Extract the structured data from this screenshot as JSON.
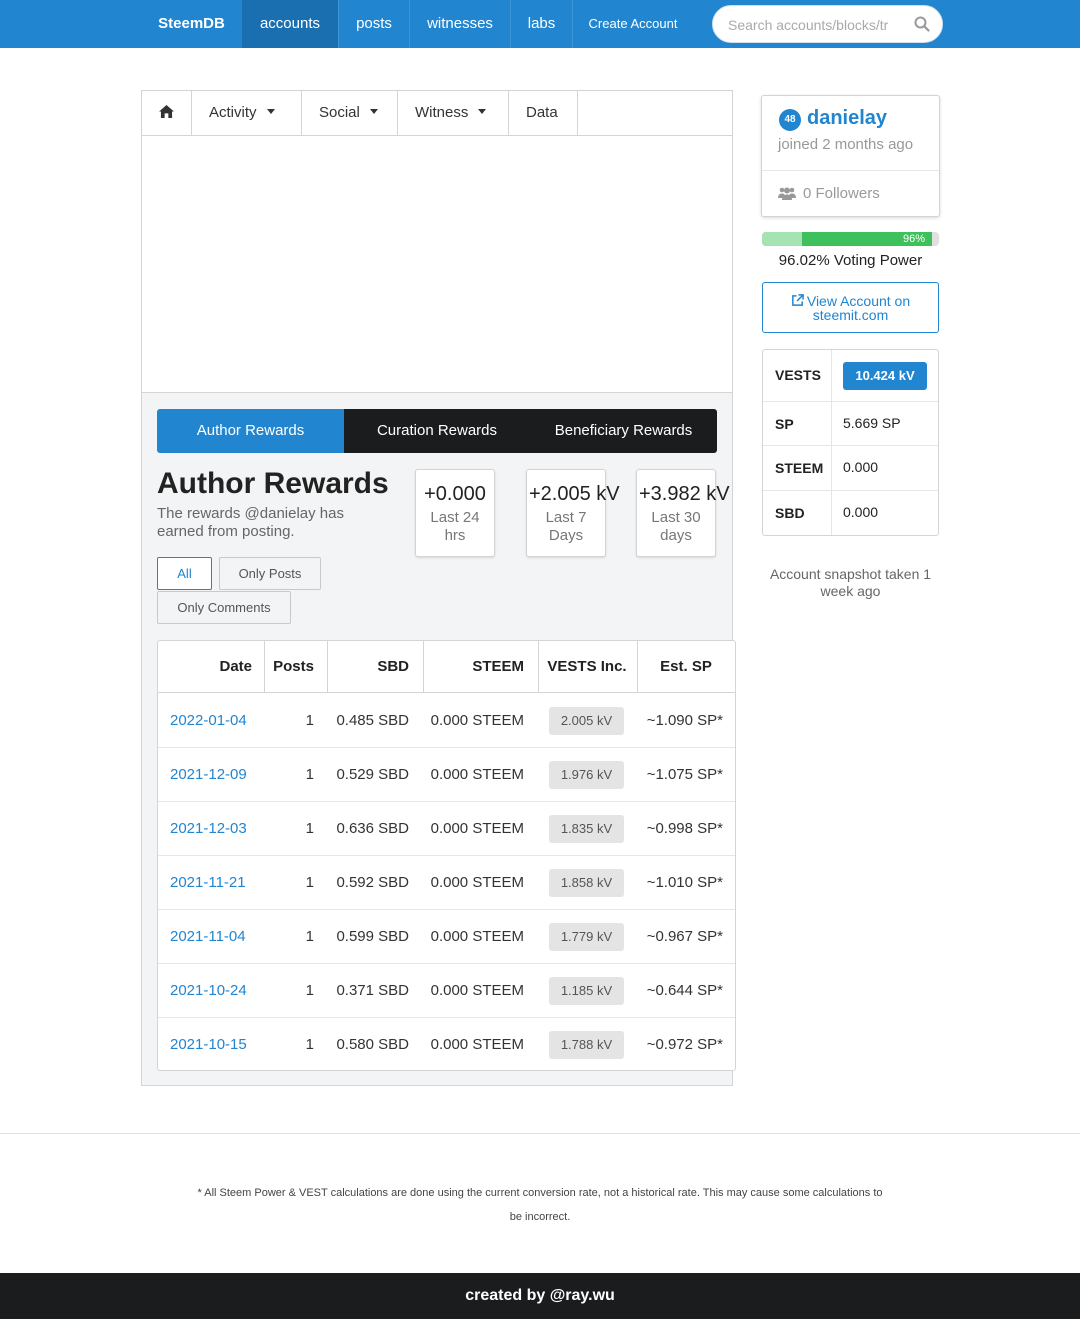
{
  "nav": {
    "brand": "SteemDB",
    "items": [
      "accounts",
      "posts",
      "witnesses",
      "labs"
    ],
    "create_account": "Create Account",
    "search_placeholder": "Search accounts/blocks/tr"
  },
  "tabs": {
    "home_icon": "home-icon",
    "items": [
      {
        "label": "Activity",
        "dropdown": true
      },
      {
        "label": "Social",
        "dropdown": true
      },
      {
        "label": "Witness",
        "dropdown": true
      },
      {
        "label": "Data",
        "dropdown": false
      }
    ]
  },
  "reward_tabs": [
    "Author Rewards",
    "Curation Rewards",
    "Beneficiary Rewards"
  ],
  "author_rewards": {
    "title": "Author Rewards",
    "description": "The rewards @danielay has earned from posting.",
    "stats": [
      {
        "value": "+0.000",
        "label": "Last 24 hrs"
      },
      {
        "value": "+2.005 kV",
        "label": "Last 7 Days"
      },
      {
        "value": "+3.982 kV",
        "label": "Last 30 days"
      }
    ],
    "filters": {
      "all": "All",
      "posts": "Only Posts",
      "comments": "Only Comments"
    }
  },
  "table": {
    "headers": [
      "Date",
      "Posts",
      "SBD",
      "STEEM",
      "VESTS Inc.",
      "Est. SP"
    ],
    "rows": [
      {
        "date": "2022-01-04",
        "posts": "1",
        "sbd": "0.485 SBD",
        "steem": "0.000 STEEM",
        "vests": "2.005 kV",
        "sp": "~1.090 SP*"
      },
      {
        "date": "2021-12-09",
        "posts": "1",
        "sbd": "0.529 SBD",
        "steem": "0.000 STEEM",
        "vests": "1.976 kV",
        "sp": "~1.075 SP*"
      },
      {
        "date": "2021-12-03",
        "posts": "1",
        "sbd": "0.636 SBD",
        "steem": "0.000 STEEM",
        "vests": "1.835 kV",
        "sp": "~0.998 SP*"
      },
      {
        "date": "2021-11-21",
        "posts": "1",
        "sbd": "0.592 SBD",
        "steem": "0.000 STEEM",
        "vests": "1.858 kV",
        "sp": "~1.010 SP*"
      },
      {
        "date": "2021-11-04",
        "posts": "1",
        "sbd": "0.599 SBD",
        "steem": "0.000 STEEM",
        "vests": "1.779 kV",
        "sp": "~0.967 SP*"
      },
      {
        "date": "2021-10-24",
        "posts": "1",
        "sbd": "0.371 SBD",
        "steem": "0.000 STEEM",
        "vests": "1.185 kV",
        "sp": "~0.644 SP*"
      },
      {
        "date": "2021-10-15",
        "posts": "1",
        "sbd": "0.580 SBD",
        "steem": "0.000 STEEM",
        "vests": "1.788 kV",
        "sp": "~0.972 SP*"
      }
    ]
  },
  "profile": {
    "reputation": "48",
    "username": "danielay",
    "joined": "joined 2 months ago",
    "followers": "0 Followers"
  },
  "voting_power": {
    "percent_label": "96%",
    "text": "96.02% Voting Power",
    "value": 96.02
  },
  "view_account": {
    "line1": "View Account on",
    "line2": "steemit.com"
  },
  "balances": [
    {
      "key": "VESTS",
      "value": "10.424 kV"
    },
    {
      "key": "SP",
      "value": "5.669 SP"
    },
    {
      "key": "STEEM",
      "value": "0.000"
    },
    {
      "key": "SBD",
      "value": "0.000"
    }
  ],
  "snapshot": "Account snapshot taken 1 week ago",
  "footnote": "* All Steem Power & VEST calculations are done using the current conversion rate, not a historical rate. This may cause some calculations to be incorrect.",
  "credit": "created by @ray.wu",
  "colors": {
    "primary": "#2185d0",
    "dark": "#1b1c1d",
    "green": "#21ba45"
  }
}
